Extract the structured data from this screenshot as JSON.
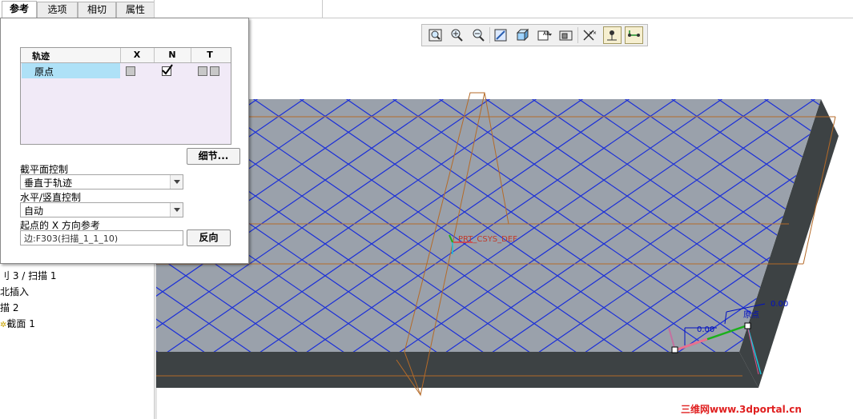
{
  "tabs": [
    {
      "label": "参考",
      "active": true
    },
    {
      "label": "选项",
      "active": false
    },
    {
      "label": "相切",
      "active": false
    },
    {
      "label": "属性",
      "active": false
    }
  ],
  "trajectory_table": {
    "columns": [
      "轨迹",
      "X",
      "N",
      "T"
    ],
    "rows": [
      {
        "name": "原点",
        "x_checked": false,
        "n_checked": true,
        "t_checked": [
          false,
          false
        ]
      }
    ]
  },
  "details_button": "细节...",
  "section_plane_control": {
    "label": "截平面控制",
    "value": "垂直于轨迹"
  },
  "horiz_vert_control": {
    "label": "水平/竖直控制",
    "value": "自动"
  },
  "start_x_ref": {
    "label": "起点的 X 方向参考",
    "value": "边:F303(扫描_1_1_10)"
  },
  "flip_button": "反向",
  "tree_items": [
    "刂 3 / 扫描 1",
    "北插入",
    "描 2",
    "截面 1"
  ],
  "viewport": {
    "csys_label": "PRT_CSYS_DEF",
    "origin_label": "原点",
    "dim_a": "0.00",
    "dim_b": "0.00"
  },
  "watermark": "三维网www.3dportal.cn",
  "colors": {
    "panel_selection": "#aee1f7",
    "table_bg": "#f1eaf7",
    "surface": "#9aa1ab",
    "side": "#3d4244",
    "hatch": "#1b2fd8",
    "datum": "#b46a28",
    "watermark": "#e02020"
  },
  "toolbar_icons": [
    "refit-icon",
    "zoom-in-icon",
    "zoom-out-icon",
    "repaint-icon",
    "shading-icon",
    "saved-views-icon",
    "view-manager-icon",
    "datum-display-icon",
    "annotation-display-icon",
    "csys-display-icon"
  ]
}
